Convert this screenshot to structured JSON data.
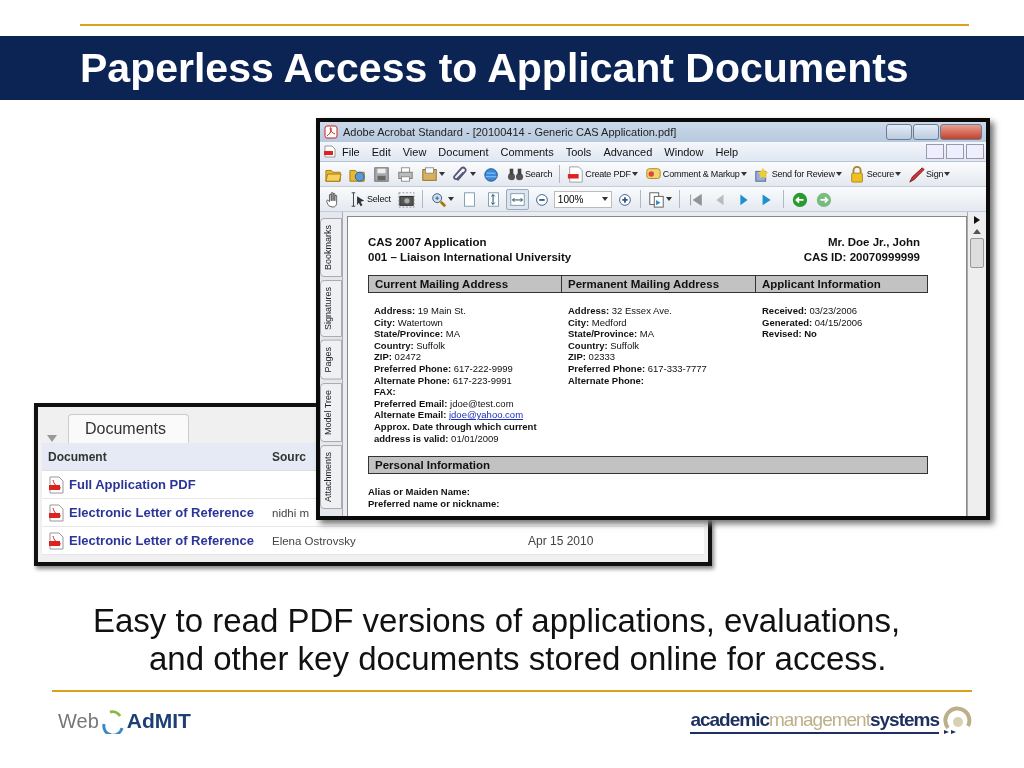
{
  "slide": {
    "title": "Paperless Access to Applicant Documents",
    "caption": "Easy to read PDF versions of applications, evaluations, and other key documents stored online for access."
  },
  "documents_panel": {
    "tab": "Documents",
    "columns": [
      "Document",
      "Sourc"
    ],
    "rows": [
      {
        "document": "Full Application PDF"
      },
      {
        "document": "Electronic Letter of Reference",
        "source": "nidhi m"
      },
      {
        "document": "Electronic Letter of Reference",
        "source": "Elena Ostrovsky",
        "date": "Apr 15 2010"
      }
    ]
  },
  "acrobat": {
    "title": "Adobe Acrobat Standard - [20100414 - Generic CAS Application.pdf]",
    "menu": [
      "File",
      "Edit",
      "View",
      "Document",
      "Comments",
      "Tools",
      "Advanced",
      "Window",
      "Help"
    ],
    "toolbar1": [
      {
        "kind": "button",
        "dropdown": false
      },
      {
        "kind": "button",
        "dropdown": false
      },
      {
        "kind": "button",
        "dropdown": false
      },
      {
        "kind": "button",
        "dropdown": false
      },
      {
        "kind": "button",
        "dropdown": true
      },
      {
        "kind": "button",
        "dropdown": true
      },
      {
        "kind": "button",
        "dropdown": false
      },
      {
        "kind": "button",
        "label": "Search",
        "dropdown": false
      },
      {
        "kind": "separator"
      },
      {
        "kind": "button",
        "label": "Create PDF",
        "dropdown": true
      },
      {
        "kind": "button",
        "label": "Comment & Markup",
        "dropdown": true
      },
      {
        "kind": "button",
        "label": "Send for Review",
        "dropdown": true
      },
      {
        "kind": "button",
        "label": "Secure",
        "dropdown": true
      },
      {
        "kind": "button",
        "label": "Sign",
        "dropdown": true
      }
    ],
    "toolbar2": [
      {
        "kind": "button",
        "dropdown": false,
        "selected": false,
        "disabled": false
      },
      {
        "kind": "button",
        "label": "Select",
        "dropdown": false,
        "selected": false,
        "disabled": false
      },
      {
        "kind": "button",
        "dropdown": false,
        "selected": false,
        "disabled": false
      },
      {
        "kind": "separator"
      },
      {
        "kind": "button",
        "dropdown": true,
        "selected": false,
        "disabled": false
      },
      {
        "kind": "button",
        "dropdown": false,
        "selected": false,
        "disabled": false
      },
      {
        "kind": "button",
        "dropdown": false,
        "selected": false,
        "disabled": false
      },
      {
        "kind": "button",
        "dropdown": false,
        "selected": true,
        "disabled": false
      },
      {
        "kind": "button",
        "dropdown": false,
        "selected": false,
        "disabled": false
      },
      {
        "kind": "field",
        "value": "100%",
        "dropdown": true
      },
      {
        "kind": "button",
        "dropdown": false,
        "selected": false,
        "disabled": false
      },
      {
        "kind": "separator"
      },
      {
        "kind": "button",
        "dropdown": true,
        "selected": false,
        "disabled": false
      },
      {
        "kind": "separator"
      },
      {
        "kind": "button",
        "dropdown": false,
        "selected": false,
        "disabled": true
      },
      {
        "kind": "button",
        "dropdown": false,
        "selected": false,
        "disabled": true
      },
      {
        "kind": "button",
        "dropdown": false,
        "selected": false,
        "disabled": false
      },
      {
        "kind": "button",
        "dropdown": false,
        "selected": false,
        "disabled": false
      },
      {
        "kind": "separator"
      },
      {
        "kind": "button",
        "dropdown": false,
        "selected": false,
        "disabled": false
      },
      {
        "kind": "button",
        "dropdown": false,
        "selected": false,
        "disabled": true
      }
    ],
    "side_tabs": [
      {
        "label": "Bookmarks",
        "selected": false
      },
      {
        "label": "Signatures",
        "selected": false
      },
      {
        "label": "Pages",
        "selected": false
      },
      {
        "label": "Model Tree",
        "selected": false
      },
      {
        "label": "Attachments",
        "selected": false
      }
    ],
    "document": {
      "heading_left": [
        "CAS 2007 Application",
        "001 – Liaison International University"
      ],
      "heading_right": [
        "Mr. Doe Jr., John",
        "CAS ID: 20070999999"
      ],
      "sections": [
        {
          "title": "Current Mailing Address",
          "fields": [
            {
              "label": "Address:",
              "value": "19 Main St."
            },
            {
              "label": "City:",
              "value": "Watertown"
            },
            {
              "label": "State/Province:",
              "value": "MA"
            },
            {
              "label": "Country:",
              "value": "Suffolk"
            },
            {
              "label": "ZIP:",
              "value": "02472"
            },
            {
              "label": "Preferred Phone:",
              "value": "617-222-9999"
            },
            {
              "label": "Alternate Phone:",
              "value": "617-223-9991"
            },
            {
              "label": "FAX:"
            },
            {
              "label": "Preferred Email:",
              "value": "jdoe@test.com"
            },
            {
              "label": "Alternate Email:",
              "value": "jdoe@yahoo.com",
              "kind": "link"
            },
            {
              "label": "Approx. Date through which current address is valid:",
              "value": "01/01/2009"
            }
          ]
        },
        {
          "title": "Permanent Mailing Address",
          "fields": [
            {
              "label": "Address:",
              "value": "32 Essex Ave."
            },
            {
              "label": "City:",
              "value": "Medford"
            },
            {
              "label": "State/Province:",
              "value": "MA"
            },
            {
              "label": "Country:",
              "value": "Suffolk"
            },
            {
              "label": "ZIP:",
              "value": "02333"
            },
            {
              "label": "Preferred Phone:",
              "value": "617-333-7777"
            },
            {
              "label": "Alternate Phone:"
            }
          ]
        },
        {
          "title": "Applicant Information",
          "fields": [
            {
              "label": "Received:",
              "value": "03/23/2006"
            },
            {
              "label": "Generated:",
              "value": "04/15/2006"
            },
            {
              "label": "Revised:",
              "value": "No",
              "bold": true
            }
          ]
        }
      ],
      "personal": {
        "title": "Personal Information",
        "fields": [
          {
            "label": "Alias or Maiden Name:"
          },
          {
            "label": "Preferred name or nickname:"
          }
        ]
      }
    }
  },
  "footer": {
    "left_logo": [
      "Web",
      "AdMIT"
    ],
    "right_logo": [
      "academic",
      "management",
      "systems"
    ]
  }
}
